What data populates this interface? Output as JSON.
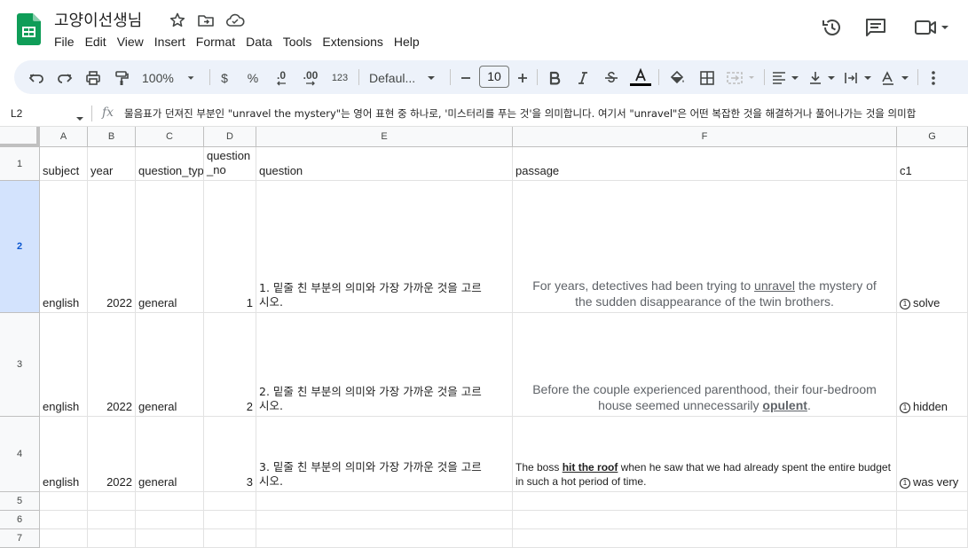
{
  "doc": {
    "title": "고양이선생님",
    "menu": [
      "File",
      "Edit",
      "View",
      "Insert",
      "Format",
      "Data",
      "Tools",
      "Extensions",
      "Help"
    ]
  },
  "toolbar": {
    "zoom": "100%",
    "currency": "$",
    "percent": "%",
    "dec_decrease": ".0",
    "dec_increase": ".00",
    "number_format": "123",
    "font": "Defaul...",
    "font_size": "10"
  },
  "formula_bar": {
    "cell_ref": "L2",
    "fx": "fx",
    "content": "물음표가 던져진 부분인 \"unravel the mystery\"는 영어 표현 중 하나로, '미스터리를 푸는 것'을 의미합니다. 여기서 \"unravel\"은 어떤 복잡한 것을 해결하거나 풀어나가는 것을 의미합"
  },
  "columns": [
    "A",
    "B",
    "C",
    "D",
    "E",
    "F",
    "G"
  ],
  "rows": [
    "1",
    "2",
    "3",
    "4",
    "5",
    "6",
    "7"
  ],
  "header_row": {
    "subject": "subject",
    "year": "year",
    "question_type": "question_typ",
    "question_no": "question_no",
    "question": "question",
    "passage": "passage",
    "c1": "c1"
  },
  "data_rows": [
    {
      "subject": "english",
      "year": "2022",
      "question_type": "general",
      "question_no": "1",
      "question": "1. 밑줄 친 부분의 의미와 가장 가까운 것을 고르시오.",
      "passage_pre": "For years, detectives had been trying to ",
      "passage_u": "unravel",
      "passage_post": " the mystery of the sudden disappearance of the twin brothers.",
      "c1_mark": "1",
      "c1": "solve"
    },
    {
      "subject": "english",
      "year": "2022",
      "question_type": "general",
      "question_no": "2",
      "question": "2. 밑줄 친 부분의 의미와 가장 가까운 것을 고르시오.",
      "passage_pre": "Before the couple experienced parenthood, their four-bedroom house seemed unnecessarily ",
      "passage_u": "opulent",
      "passage_post": ".",
      "c1_mark": "1",
      "c1": "hidden"
    },
    {
      "subject": "english",
      "year": "2022",
      "question_type": "general",
      "question_no": "3",
      "question": "3. 밑줄 친 부분의 의미와 가장 가까운 것을 고르시오.",
      "passage_pre": "The boss ",
      "passage_u": "hit the roof",
      "passage_post": " when he saw that we had already spent the entire budget in such a hot period of time.",
      "c1_mark": "1",
      "c1": "was very"
    }
  ]
}
